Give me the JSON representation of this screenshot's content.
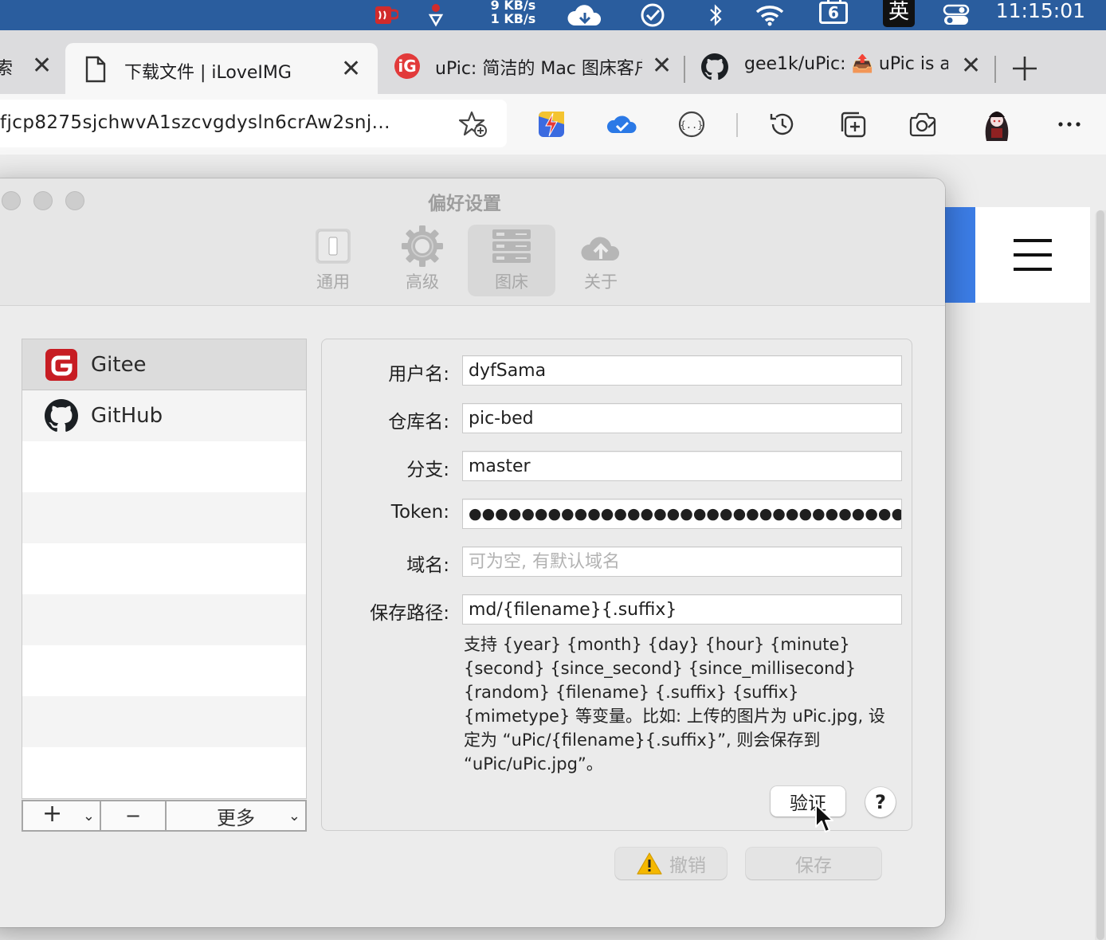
{
  "menubar": {
    "net_up": "9 KB/s",
    "net_down": "1 KB/s",
    "calendar_day": "6",
    "input_method": "英",
    "clock": "11:15:01"
  },
  "tabs": [
    {
      "title": "索",
      "icon": "search-icon"
    },
    {
      "title": "下载文件 | iLoveIMG",
      "icon": "document-icon",
      "active": true
    },
    {
      "title": "uPic: 简洁的 Mac 图床客户端",
      "icon": "upic-icon"
    },
    {
      "title": "gee1k/uPic: 📤 uPic is a",
      "icon": "github-icon"
    }
  ],
  "toolbar": {
    "url": "fjcp8275sjchwvA1szcvgdysln6crAw2snj..."
  },
  "prefs": {
    "window_title": "偏好设置",
    "tabs": [
      {
        "label": "通用",
        "icon": "switch-icon"
      },
      {
        "label": "高级",
        "icon": "gear-icon"
      },
      {
        "label": "图床",
        "icon": "server-icon"
      },
      {
        "label": "关于",
        "icon": "cloud-upload-icon"
      }
    ],
    "hosts": [
      {
        "name": "Gitee",
        "icon": "gitee-icon"
      },
      {
        "name": "GitHub",
        "icon": "github-icon"
      }
    ],
    "list_controls": {
      "add": "+",
      "remove": "−",
      "more": "更多"
    },
    "form": {
      "username_label": "用户名:",
      "username_value": "dyfSama",
      "repo_label": "仓库名:",
      "repo_value": "pic-bed",
      "branch_label": "分支:",
      "branch_value": "master",
      "token_label": "Token:",
      "token_value": "●●●●●●●●●●●●●●●●●●●●●●●●●●●●●●●●●●",
      "domain_label": "域名:",
      "domain_placeholder": "可为空, 有默认域名",
      "path_label": "保存路径:",
      "path_value": "md/{filename}{.suffix}",
      "help_text": "支持 {year} {month} {day} {hour} {minute} {second} {since_second} {since_millisecond} {random} {filename} {.suffix} {suffix} {mimetype} 等变量。比如: 上传的图片为 uPic.jpg, 设定为 “uPic/{filename}{.suffix}”, 则会保存到 “uPic/uPic.jpg”。",
      "verify_label": "验证",
      "help_button": "?"
    },
    "undo_label": "撤销",
    "save_label": "保存"
  }
}
